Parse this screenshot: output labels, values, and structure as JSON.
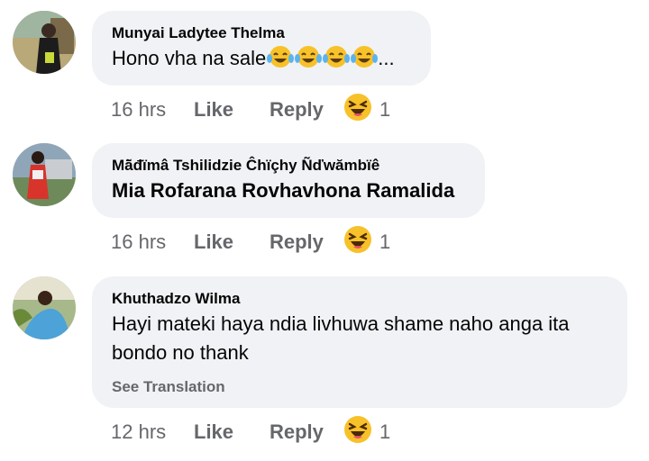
{
  "comments": [
    {
      "author": "Munyai Ladytee Thelma",
      "text": "Hono vha na sale",
      "trailing_emojis": [
        "face-with-tears-of-joy-icon",
        "face-with-tears-of-joy-icon",
        "face-with-tears-of-joy-icon",
        "face-with-tears-of-joy-icon"
      ],
      "ellipsis": "...",
      "time": "16 hrs",
      "like_label": "Like",
      "reply_label": "Reply",
      "reaction_icon": "laughing-squinting-face-icon",
      "reaction_count": "1"
    },
    {
      "author": "Mā̃đïmâ Tshilidzie Ĉhïçhy Ñďwămbïê",
      "text": "Mia Rofarana Rovhavhona Ramalida",
      "time": "16 hrs",
      "like_label": "Like",
      "reply_label": "Reply",
      "reaction_icon": "laughing-squinting-face-icon",
      "reaction_count": "1"
    },
    {
      "author": "Khuthadzo Wilma",
      "text": "Hayi mateki haya ndia livhuwa shame naho anga ita bondo no thank",
      "see_translation": "See Translation",
      "time": "12 hrs",
      "like_label": "Like",
      "reply_label": "Reply",
      "reaction_icon": "laughing-squinting-face-icon",
      "reaction_count": "1"
    }
  ],
  "colors": {
    "bubble": "#f0f2f5",
    "meta_text": "#65676b",
    "text": "#050505",
    "emoji": "#f7c12a"
  }
}
